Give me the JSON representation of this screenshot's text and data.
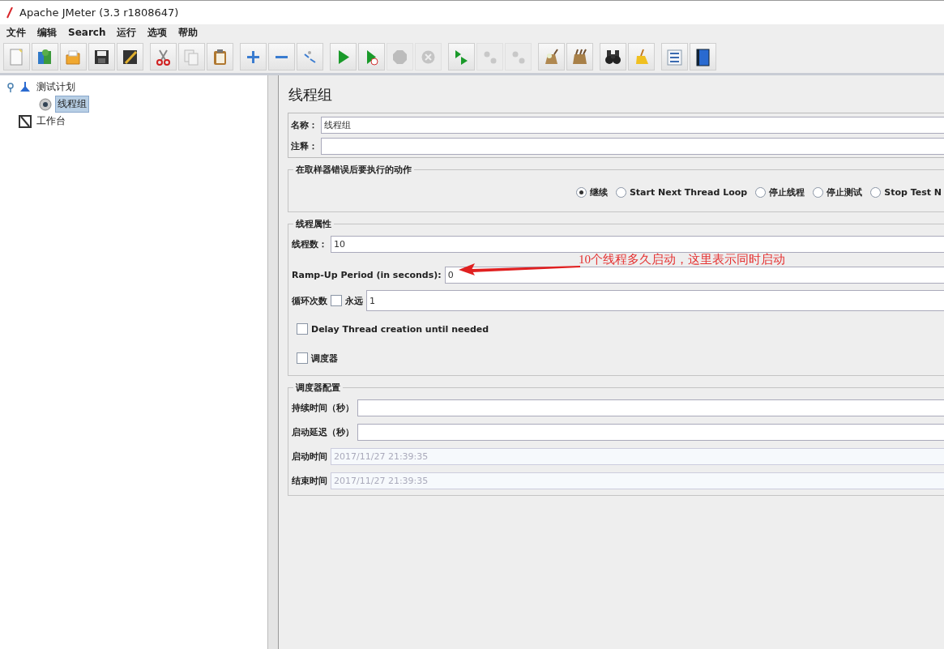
{
  "window": {
    "title": "Apache JMeter (3.3 r1808647)"
  },
  "menu": [
    "文件",
    "编辑",
    "Search",
    "运行",
    "选项",
    "帮助"
  ],
  "toolbar": [
    [
      {
        "kind": "new",
        "disabled": false
      },
      {
        "kind": "templates",
        "disabled": false
      },
      {
        "kind": "open",
        "disabled": false
      },
      {
        "kind": "save",
        "disabled": false
      },
      {
        "kind": "save-as",
        "disabled": false
      }
    ],
    [
      {
        "kind": "cut",
        "disabled": false
      },
      {
        "kind": "copy",
        "disabled": false
      },
      {
        "kind": "paste",
        "disabled": false
      }
    ],
    [
      {
        "kind": "expand",
        "disabled": false
      },
      {
        "kind": "collapse",
        "disabled": false
      },
      {
        "kind": "toggle",
        "disabled": false
      }
    ],
    [
      {
        "kind": "start",
        "disabled": false
      },
      {
        "kind": "start-no-pause",
        "disabled": false
      },
      {
        "kind": "stop",
        "disabled": true
      },
      {
        "kind": "shutdown",
        "disabled": true
      }
    ],
    [
      {
        "kind": "remote-start",
        "disabled": false
      },
      {
        "kind": "remote-stop",
        "disabled": true
      },
      {
        "kind": "remote-exit",
        "disabled": true
      }
    ],
    [
      {
        "kind": "clear",
        "disabled": false
      },
      {
        "kind": "clear-all",
        "disabled": false
      }
    ],
    [
      {
        "kind": "search",
        "disabled": false
      },
      {
        "kind": "reset",
        "disabled": false
      }
    ],
    [
      {
        "kind": "function",
        "disabled": false
      },
      {
        "kind": "help",
        "disabled": false
      }
    ]
  ],
  "tree": [
    {
      "label": "测试计划",
      "kind": "plan",
      "expanded": true,
      "selected": false,
      "children": [
        {
          "label": "线程组",
          "kind": "thread-group",
          "selected": true
        }
      ]
    },
    {
      "label": "工作台",
      "kind": "workbench",
      "selected": false
    }
  ],
  "panel": {
    "title": "线程组",
    "name_label": "名称：",
    "name_value": "线程组",
    "comment_label": "注释：",
    "error_action": {
      "legend": "在取样器错误后要执行的动作",
      "options": [
        {
          "label": "继续",
          "selected": true
        },
        {
          "label": "Start Next Thread Loop",
          "selected": false
        },
        {
          "label": "停止线程",
          "selected": false
        },
        {
          "label": "停止测试",
          "selected": false
        },
        {
          "label": "Stop Test N",
          "selected": false
        }
      ]
    },
    "thread_props": {
      "legend": "线程属性",
      "threads_label": "线程数：",
      "threads_value": "10",
      "rampup_label": "Ramp-Up Period (in seconds):",
      "rampup_value": "0",
      "loop_label": "循环次数",
      "forever": {
        "label": "永远",
        "checked": false
      },
      "loop_value": "1",
      "delay": {
        "label": "Delay Thread creation until needed",
        "checked": false
      },
      "scheduler": {
        "label": "调度器",
        "checked": false
      }
    },
    "scheduler_config": {
      "legend": "调度器配置",
      "fields": [
        {
          "label": "持续时间（秒）",
          "disabled": false
        },
        {
          "label": "启动延迟（秒）",
          "disabled": false
        },
        {
          "label": "启动时间",
          "value": "2017/11/27 21:39:35",
          "disabled": true
        },
        {
          "label": "结束时间",
          "value": "2017/11/27 21:39:35",
          "disabled": true
        }
      ]
    }
  },
  "annotation": {
    "text": "10个线程多久启动，这里表示同时启动"
  }
}
